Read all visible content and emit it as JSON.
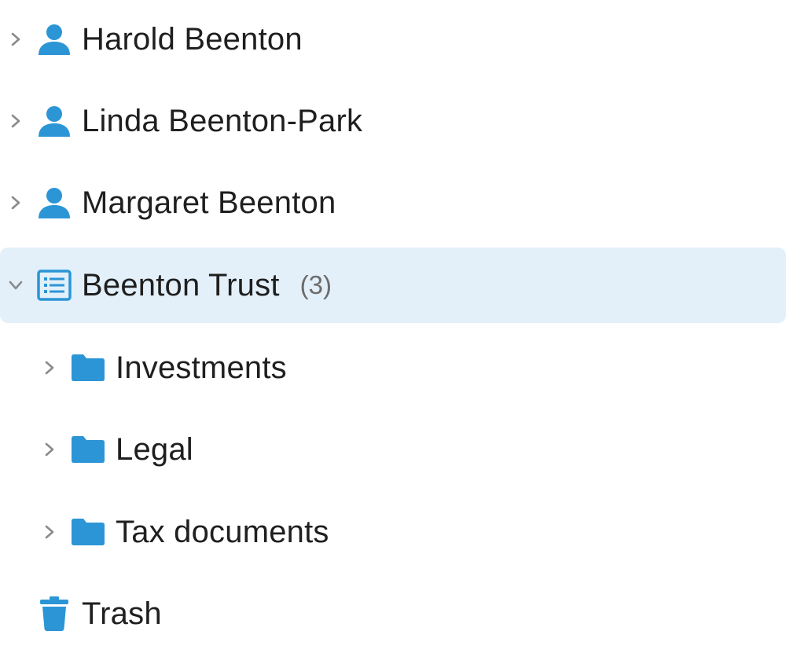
{
  "tree": {
    "contacts": [
      {
        "label": "Harold Beenton",
        "icon": "person-icon"
      },
      {
        "label": "Linda Beenton-Park",
        "icon": "person-icon"
      },
      {
        "label": "Margaret Beenton",
        "icon": "person-icon"
      }
    ],
    "trust": {
      "label": "Beenton Trust",
      "count": "(3)",
      "icon": "list-icon",
      "expanded": true,
      "selected": true,
      "children": [
        {
          "label": "Investments",
          "icon": "folder-icon"
        },
        {
          "label": "Legal",
          "icon": "folder-icon"
        },
        {
          "label": "Tax documents",
          "icon": "folder-icon"
        }
      ]
    },
    "trash": {
      "label": "Trash",
      "icon": "trash-icon"
    }
  },
  "colors": {
    "accent": "#2b95d6",
    "selected_bg": "#e3f0fa",
    "text": "#1f1f1f",
    "muted": "#6c6c6c",
    "chevron": "#8a8a8a"
  }
}
